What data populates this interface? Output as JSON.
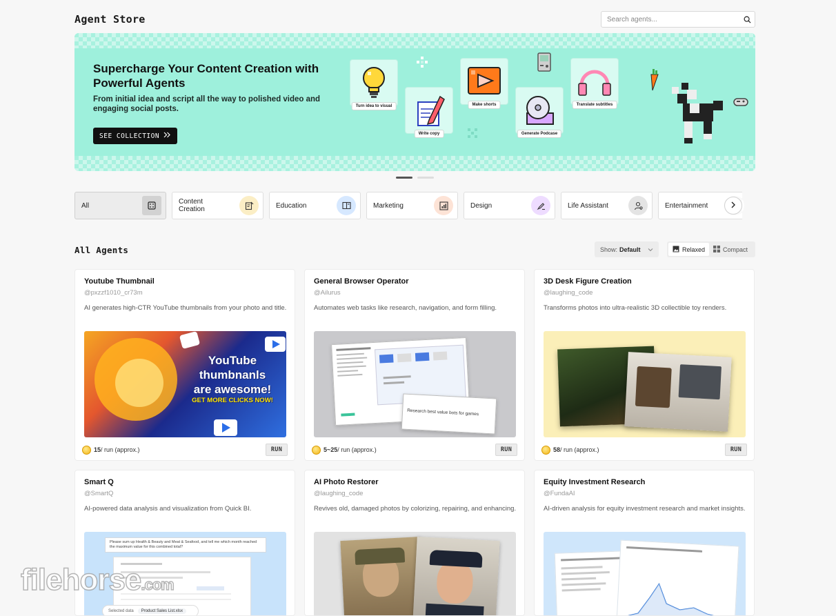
{
  "header": {
    "title": "Agent Store",
    "search_placeholder": "Search agents..."
  },
  "banner": {
    "headline": "Supercharge Your Content Creation with Powerful Agents",
    "subtitle": "From initial idea and script all the way to polished video and engaging social posts.",
    "button_label": "SEE COLLECTION",
    "tiles": [
      "Turn idea to visual",
      "Write copy",
      "Make shorts",
      "Generate Podcase",
      "Translate subtitles"
    ],
    "accent_color": "#9ef0dc",
    "slides": 2,
    "active_slide": 1
  },
  "categories": [
    {
      "label": "All",
      "icon": "dice-icon",
      "color": "#d2d2d2",
      "active": true
    },
    {
      "label": "Content Creation",
      "icon": "edit-document-icon",
      "color": "#fbeec5"
    },
    {
      "label": "Education",
      "icon": "book-icon",
      "color": "#d6e8ff"
    },
    {
      "label": "Marketing",
      "icon": "chart-icon",
      "color": "#fde3d6"
    },
    {
      "label": "Design",
      "icon": "brush-icon",
      "color": "#eedcff"
    },
    {
      "label": "Life Assistant",
      "icon": "person-icon",
      "color": "#e4e4e4"
    },
    {
      "label": "Entertainment",
      "icon": "gamepad-icon",
      "color": "#e4e4e4"
    }
  ],
  "section": {
    "title": "All Agents",
    "show_label": "Show:",
    "show_value": "Default",
    "view_relaxed": "Relaxed",
    "view_compact": "Compact"
  },
  "agents": [
    {
      "title": "Youtube Thumbnail",
      "author": "@pxzzf1010_cr73m",
      "description": "AI generates high-CTR YouTube thumbnails from your photo and title.",
      "cost": "15",
      "cost_unit": "/ run (approx.)",
      "run_label": "RUN",
      "image_text_1": "YouTube",
      "image_text_2": "thumbnanls",
      "image_text_3": "are awesome!",
      "image_text_4": "GET MORE CLICKS NOW!"
    },
    {
      "title": "General Browser Operator",
      "author": "@Ailurus",
      "description": "Automates web tasks like research, navigation, and form filling.",
      "cost": "5~25",
      "cost_unit": "/ run (approx.)",
      "run_label": "RUN",
      "image_text_1": "Research best value bots for games"
    },
    {
      "title": "3D Desk Figure Creation",
      "author": "@laughing_code",
      "description": "Transforms photos into ultra-realistic 3D collectible toy renders.",
      "cost": "58",
      "cost_unit": "/ run (approx.)",
      "run_label": "RUN"
    },
    {
      "title": "Smart Q",
      "author": "@SmartQ",
      "description": "AI-powered data analysis and visualization from Quick BI.",
      "image_text_1": "Please sum up Health & Beauty and Meat & Seafood, and tell me which month reached the maximum value for this combined total?",
      "image_text_2": "Selected data",
      "image_text_3": "Product Sales List.xlsx"
    },
    {
      "title": "AI Photo Restorer",
      "author": "@laughing_code",
      "description": "Revives old, damaged photos by colorizing, repairing, and enhancing."
    },
    {
      "title": "Equity Investment Research",
      "author": "@FundaAI",
      "description": "AI-driven analysis for equity investment research and market insights."
    }
  ],
  "watermark": {
    "name": "filehorse",
    "suffix": ".com"
  }
}
